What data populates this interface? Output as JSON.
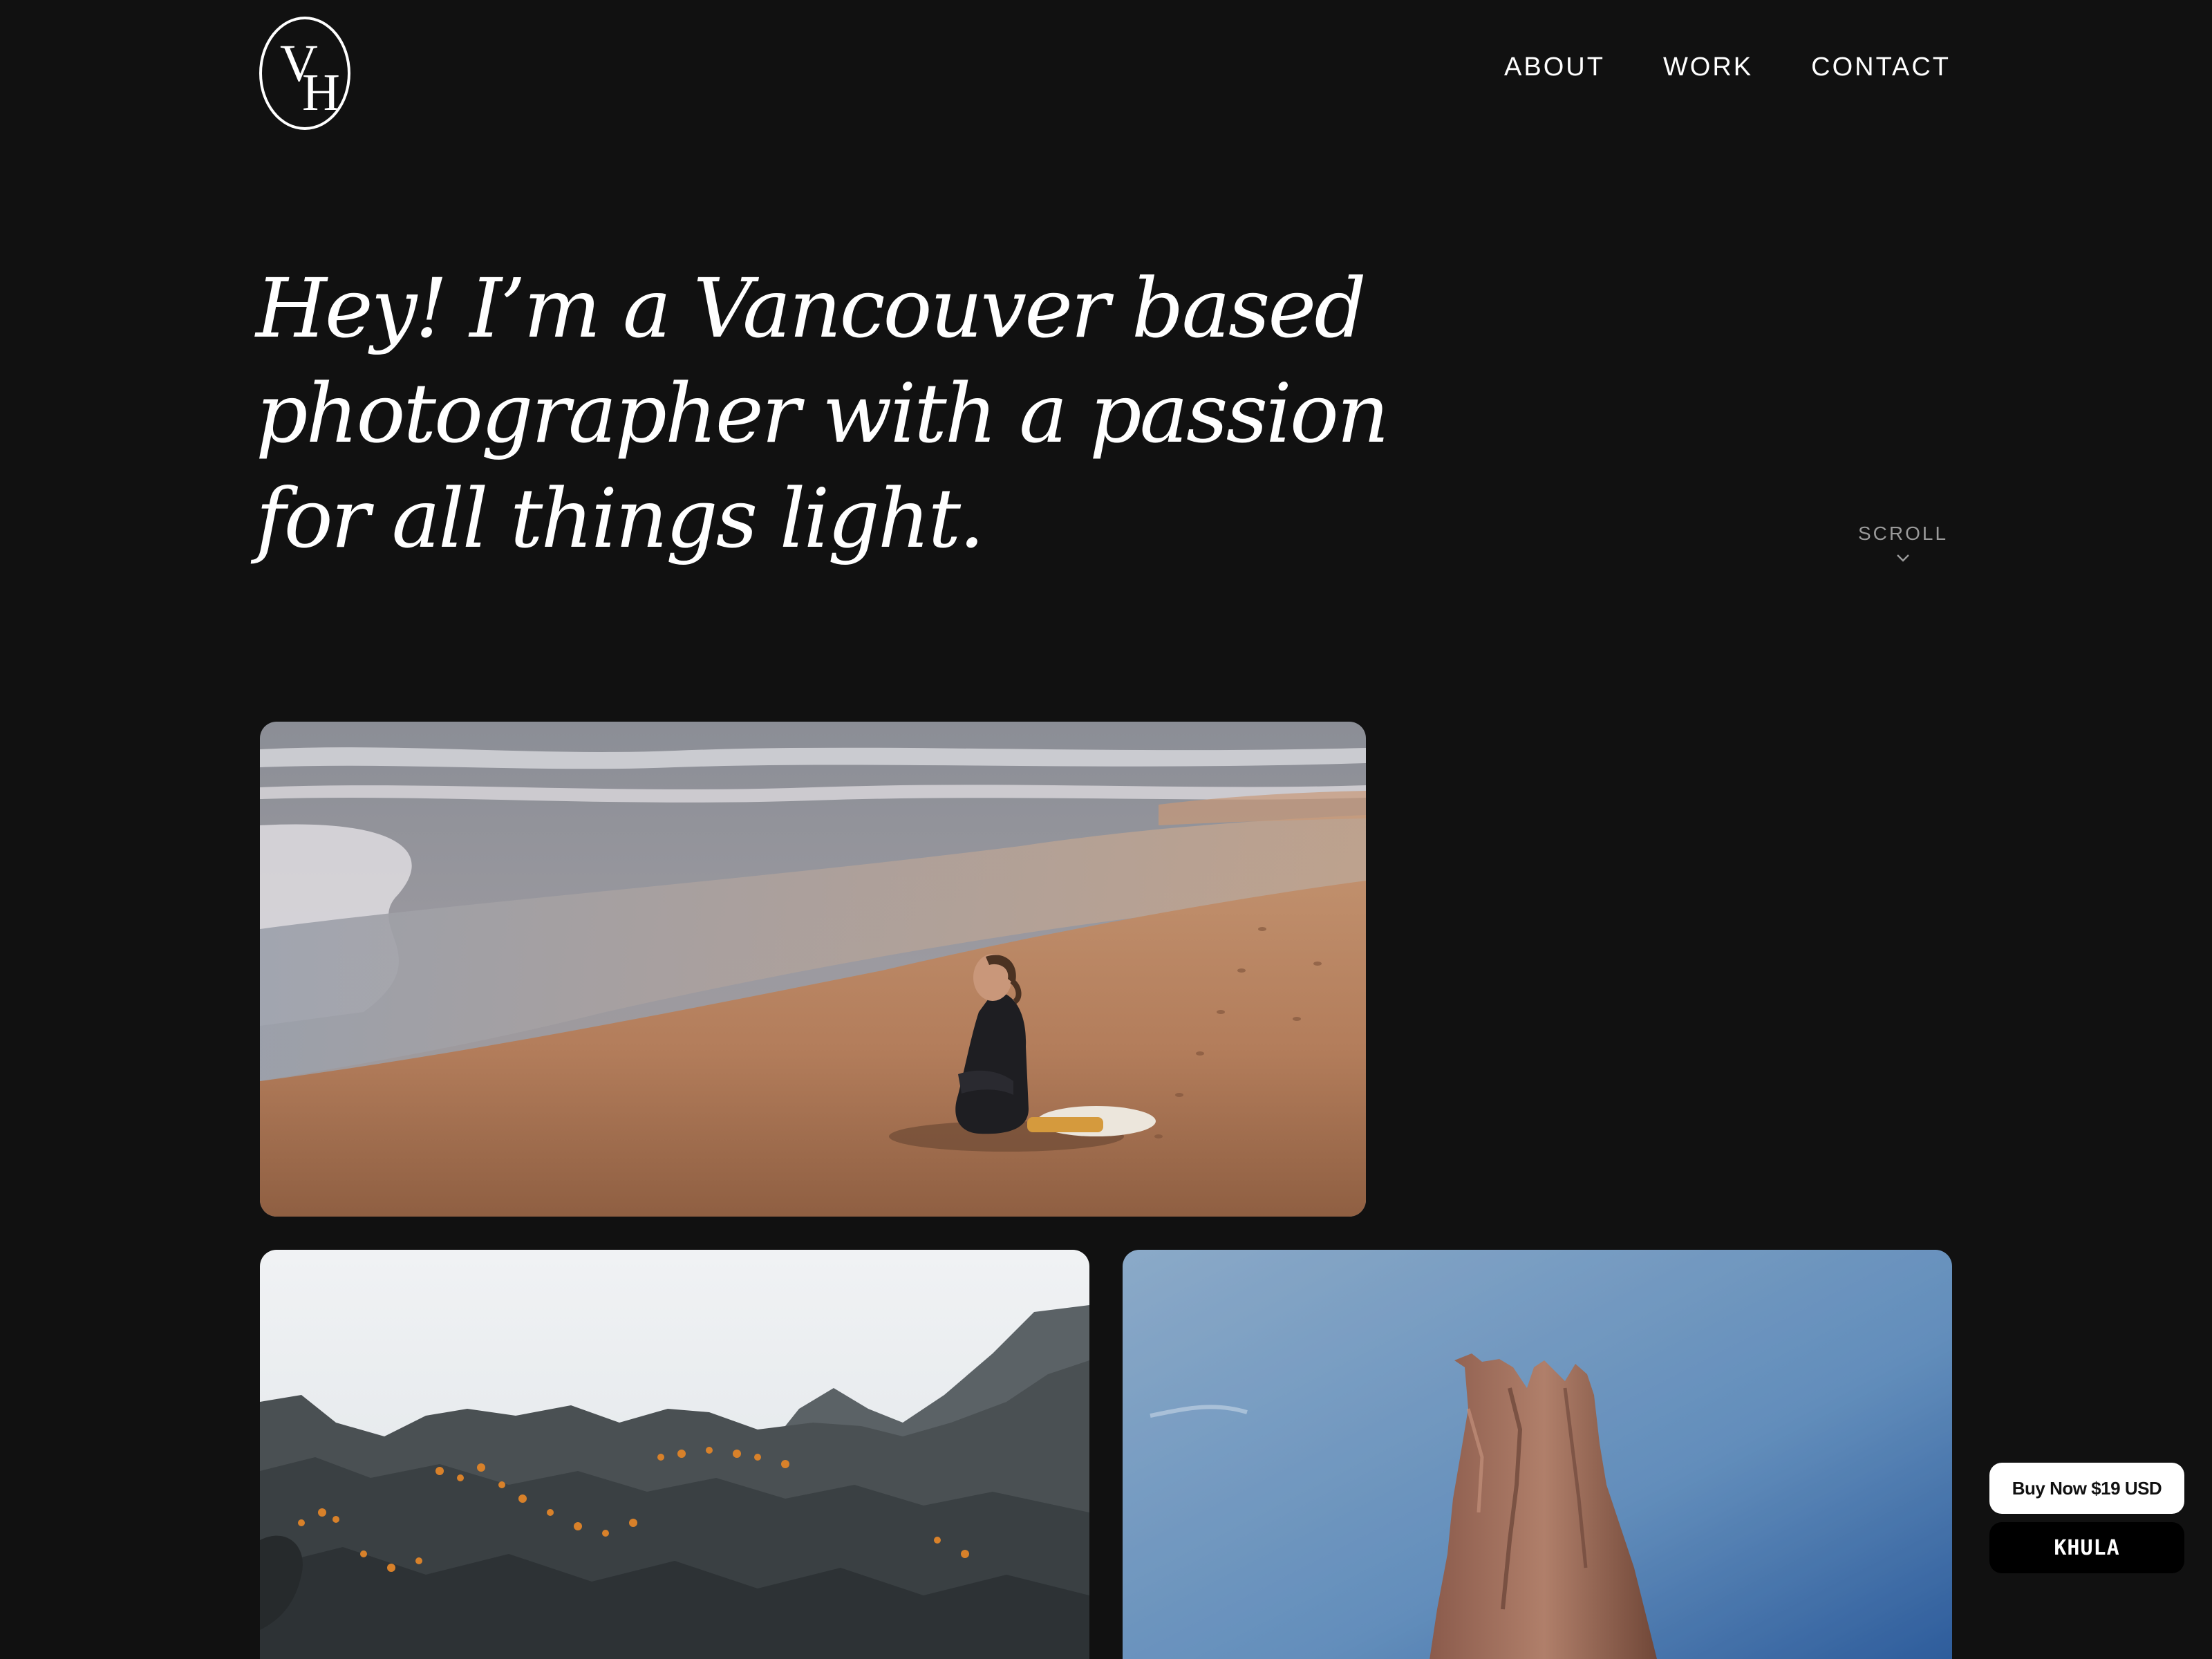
{
  "header": {
    "logo": {
      "letter_top": "V",
      "letter_bottom": "H"
    },
    "nav": [
      {
        "label": "ABOUT"
      },
      {
        "label": "WORK"
      },
      {
        "label": "CONTACT"
      }
    ]
  },
  "hero": {
    "headline": "Hey! I’m a Vancouver based photographer with a passion for all things light."
  },
  "scroll_hint": {
    "label": "SCROLL",
    "icon": "chevron-down-icon"
  },
  "gallery": [
    {
      "subject": "beach-sitting-person"
    },
    {
      "subject": "mountain-ridge"
    },
    {
      "subject": "desert-rock-spire"
    }
  ],
  "widget": {
    "buy_label": "Buy Now $19 USD",
    "brand_label": "KHULA"
  },
  "colors": {
    "background": "#111111",
    "text": "#ffffff",
    "muted": "#9a9a9a"
  }
}
